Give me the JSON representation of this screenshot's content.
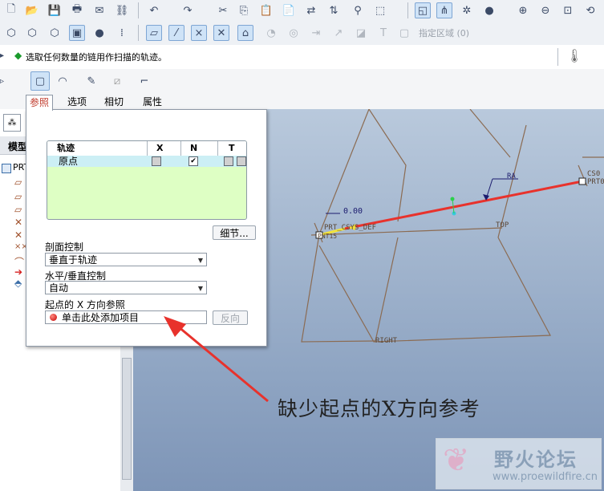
{
  "message": {
    "text": "选取任何数量的链用作扫描的轨迹。"
  },
  "toolbar": {
    "region_label": "指定区域 (0)"
  },
  "dashboard": {
    "tabs": [
      "参照",
      "选项",
      "相切",
      "属性"
    ],
    "active_tab": "参照"
  },
  "tree": {
    "tab_label": "模型",
    "root_label": "PRT"
  },
  "panel": {
    "table": {
      "headers": [
        "轨迹",
        "X",
        "N",
        "T"
      ],
      "rows": [
        {
          "name": "原点",
          "x": false,
          "n": true,
          "t": false
        }
      ]
    },
    "detail_button": "细节...",
    "section_label": "剖面控制",
    "section_value": "垂直于轨迹",
    "hv_label": "水平/垂直控制",
    "hv_value": "自动",
    "xdir_label": "起点的 X 方向参照",
    "xdir_value": "单击此处添加项目",
    "reverse_button": "反向"
  },
  "graphics": {
    "dim_value": "0.00",
    "labels": {
      "csys_left": "PRT_CSYS_DEF",
      "top": "TOP",
      "right": "RIGHT",
      "csys_right": "CS0",
      "prt_right": "PRT0",
      "left_small": "PNT15",
      "mid": "RA"
    }
  },
  "annotation": {
    "text": "缺少起点的X方向参考"
  },
  "watermark": {
    "title": "野火论坛",
    "url": "www.proewildfire.cn"
  },
  "colors": {
    "trajectory": "#e8322c",
    "arrow": "#e8322c",
    "table_bg": "#deffc4",
    "row_select": "#cceff5"
  }
}
